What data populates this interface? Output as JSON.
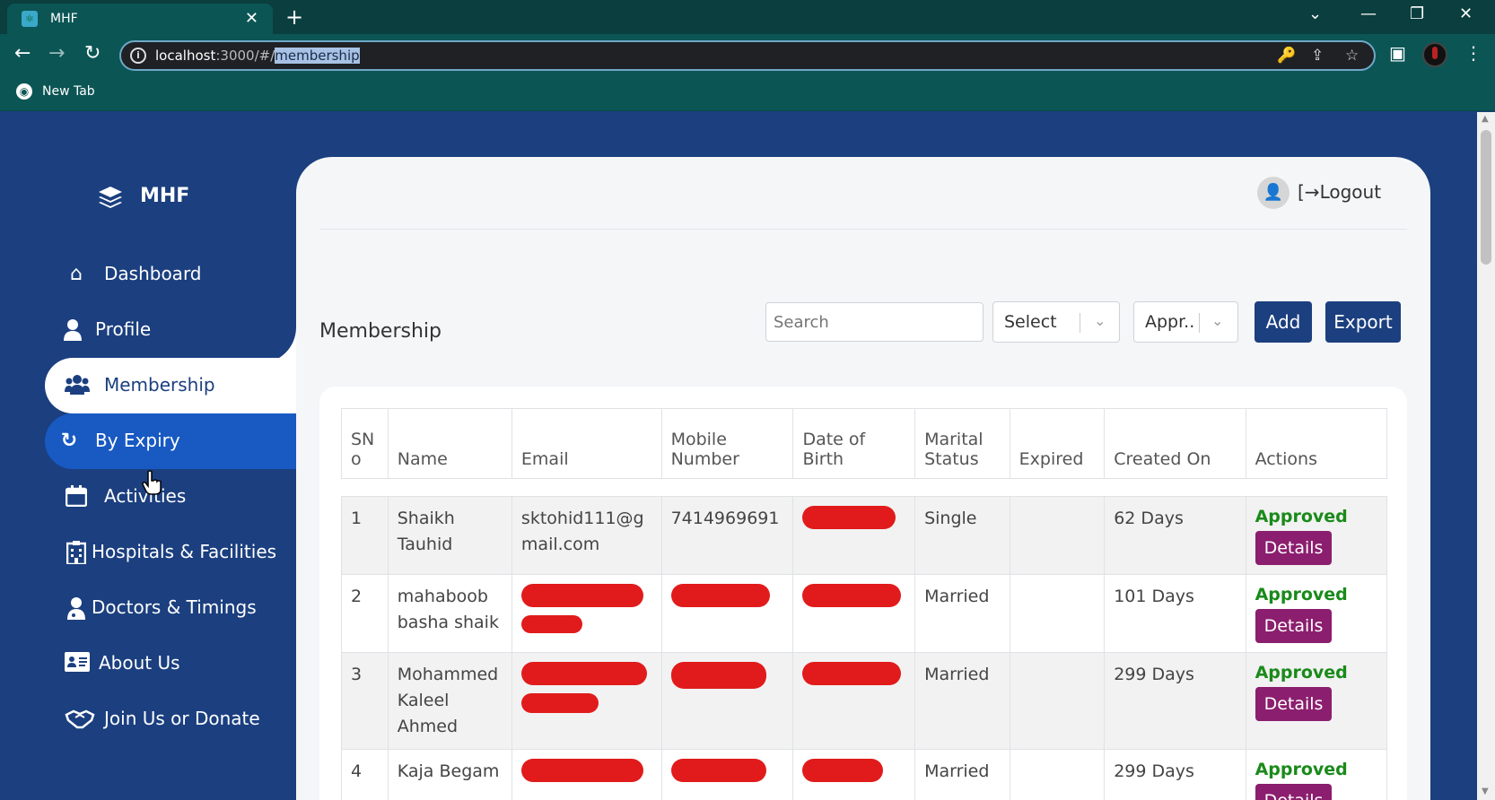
{
  "browser": {
    "tab_title": "MHF",
    "tab_close": "✕",
    "new_tab": "+",
    "url_host": "localhost",
    "url_port_path": ":3000/#/",
    "url_selected": "membership",
    "bookmark_label": "New Tab"
  },
  "sidebar": {
    "brand": "MHF",
    "items": [
      {
        "label": "Dashboard",
        "icon": "home-icon",
        "glyph": "⌂"
      },
      {
        "label": "Profile",
        "icon": "user-icon",
        "glyph": "👤"
      },
      {
        "label": "Membership",
        "icon": "users-icon",
        "glyph": "👥"
      },
      {
        "label": "By Expiry",
        "icon": "refresh-icon",
        "glyph": "↻"
      },
      {
        "label": "Activities",
        "icon": "calendar-icon",
        "glyph": "📅"
      },
      {
        "label": "Hospitals & Facilities",
        "icon": "hospital-icon",
        "glyph": "🏥"
      },
      {
        "label": "Doctors & Timings",
        "icon": "doctor-icon",
        "glyph": "⚕"
      },
      {
        "label": "About Us",
        "icon": "id-card-icon",
        "glyph": "🪪"
      },
      {
        "label": "Join Us or Donate",
        "icon": "handshake-icon",
        "glyph": "🤝"
      }
    ]
  },
  "header": {
    "logout_label": "Logout"
  },
  "main": {
    "title": "Membership",
    "search_placeholder": "Search",
    "select1_value": "Select",
    "select2_value": "Appr..",
    "add_label": "Add",
    "export_label": "Export"
  },
  "table": {
    "headers": [
      "SN o",
      "Name",
      "Email",
      "Mobile Number",
      "Date of Birth",
      "Marital Status",
      "Expired",
      "Created On",
      "Actions"
    ],
    "header_lines": [
      [
        "SN",
        "o"
      ],
      [
        "",
        "Name"
      ],
      [
        "",
        "Email"
      ],
      [
        "Mobile",
        "Number"
      ],
      [
        "",
        "Date of Birth"
      ],
      [
        "Marital",
        "Status"
      ],
      [
        "",
        "Expired"
      ],
      [
        "",
        "Created On"
      ],
      [
        "",
        "Actions"
      ]
    ],
    "rows": [
      {
        "sno": "1",
        "name": "Shaikh Tauhid",
        "email": "sktohid111@gmail.com",
        "mobile": "7414969691",
        "marital": "Single",
        "expired": "",
        "created": "62 Days",
        "status": "Approved",
        "action": "Details"
      },
      {
        "sno": "2",
        "name": "mahaboob basha shaik",
        "email": "",
        "mobile": "",
        "marital": "Married",
        "expired": "",
        "created": "101 Days",
        "status": "Approved",
        "action": "Details"
      },
      {
        "sno": "3",
        "name": "Mohammed Kaleel Ahmed",
        "email": "",
        "mobile": "",
        "marital": "Married",
        "expired": "",
        "created": "299 Days",
        "status": "Approved",
        "action": "Details"
      },
      {
        "sno": "4",
        "name": "Kaja Begam",
        "email": "",
        "mobile": "",
        "marital": "Married",
        "expired": "",
        "created": "299 Days",
        "status": "Approved",
        "action": "Details"
      }
    ]
  },
  "colors": {
    "sidebar_bg": "#1b3f7f",
    "active_expiry": "#1859c2",
    "approved": "#1a8a1a",
    "details_btn": "#8b1e6e",
    "redaction": "#e11b1b"
  }
}
